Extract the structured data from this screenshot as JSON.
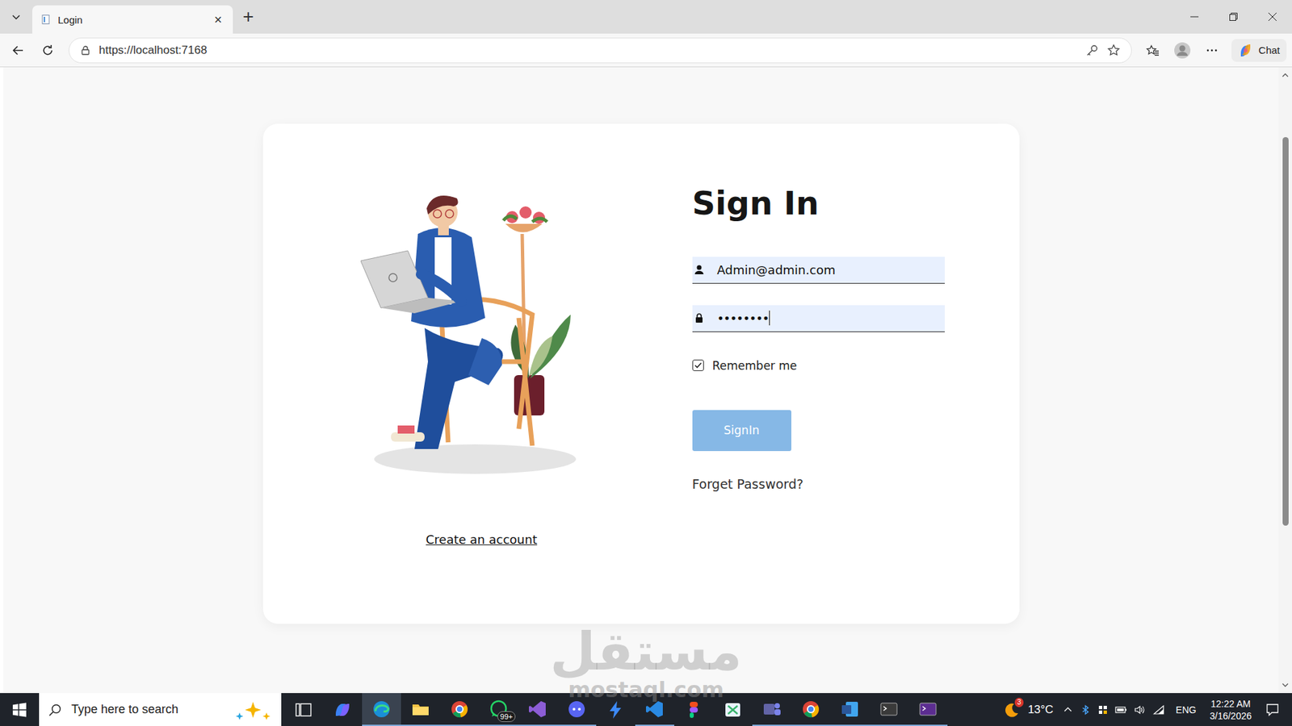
{
  "browser": {
    "tab": {
      "title": "Login",
      "close": "×",
      "selected": true
    },
    "new_tab": "+",
    "address": {
      "url": "https://localhost:7168"
    },
    "chat_button": "Chat"
  },
  "page": {
    "heading": "Sign In",
    "email": {
      "value": "Admin@admin.com",
      "focused": false
    },
    "password": {
      "value": "••••••••",
      "focused": true
    },
    "remember": {
      "label": "Remember me",
      "checked": true
    },
    "submit": "SignIn",
    "forgot": "Forget Password?",
    "create": "Create an account"
  },
  "watermark": {
    "arabic": "مستقل",
    "latin": "mostaql.com"
  },
  "taskbar": {
    "search_placeholder": "Type here to search",
    "apps": [
      {
        "kind": "taskview",
        "color": "#ffffff",
        "running": false,
        "selected": false,
        "badge": ""
      },
      {
        "kind": "copilot",
        "color": "#7b61ff",
        "running": false,
        "selected": false,
        "badge": ""
      },
      {
        "kind": "edge",
        "color": "#1a8fd8",
        "running": true,
        "selected": true,
        "badge": ""
      },
      {
        "kind": "folder",
        "color": "#f3c244",
        "running": true,
        "selected": false,
        "badge": ""
      },
      {
        "kind": "chrome",
        "color": "#db4437",
        "running": true,
        "selected": false,
        "badge": ""
      },
      {
        "kind": "whatsapp",
        "color": "#25d366",
        "running": true,
        "selected": false,
        "badge": "99+"
      },
      {
        "kind": "vs",
        "color": "#8c5dd6",
        "running": true,
        "selected": false,
        "badge": ""
      },
      {
        "kind": "chat",
        "color": "#5865f2",
        "running": true,
        "selected": false,
        "badge": ""
      },
      {
        "kind": "bolt",
        "color": "#3d8af7",
        "running": false,
        "selected": false,
        "badge": ""
      },
      {
        "kind": "vs",
        "color": "#2a8ae3",
        "running": true,
        "selected": false,
        "badge": ""
      },
      {
        "kind": "figma",
        "color": "#a259ff",
        "running": false,
        "selected": false,
        "badge": ""
      },
      {
        "kind": "snip",
        "color": "#38b26a",
        "running": false,
        "selected": false,
        "badge": ""
      },
      {
        "kind": "teams",
        "color": "#6264a7",
        "running": true,
        "selected": false,
        "badge": ""
      },
      {
        "kind": "chrome",
        "color": "#db4437",
        "running": true,
        "selected": false,
        "badge": ""
      },
      {
        "kind": "word",
        "color": "#2b579a",
        "running": true,
        "selected": false,
        "badge": ""
      },
      {
        "kind": "terminal",
        "color": "#3a3a3a",
        "running": true,
        "selected": false,
        "badge": ""
      },
      {
        "kind": "terminal",
        "color": "#5c2d91",
        "running": true,
        "selected": false,
        "badge": ""
      }
    ],
    "weather": {
      "temp": "13°C",
      "badge": "3"
    },
    "language": "ENG",
    "time": "12:22 AM",
    "date": "3/16/2026"
  }
}
